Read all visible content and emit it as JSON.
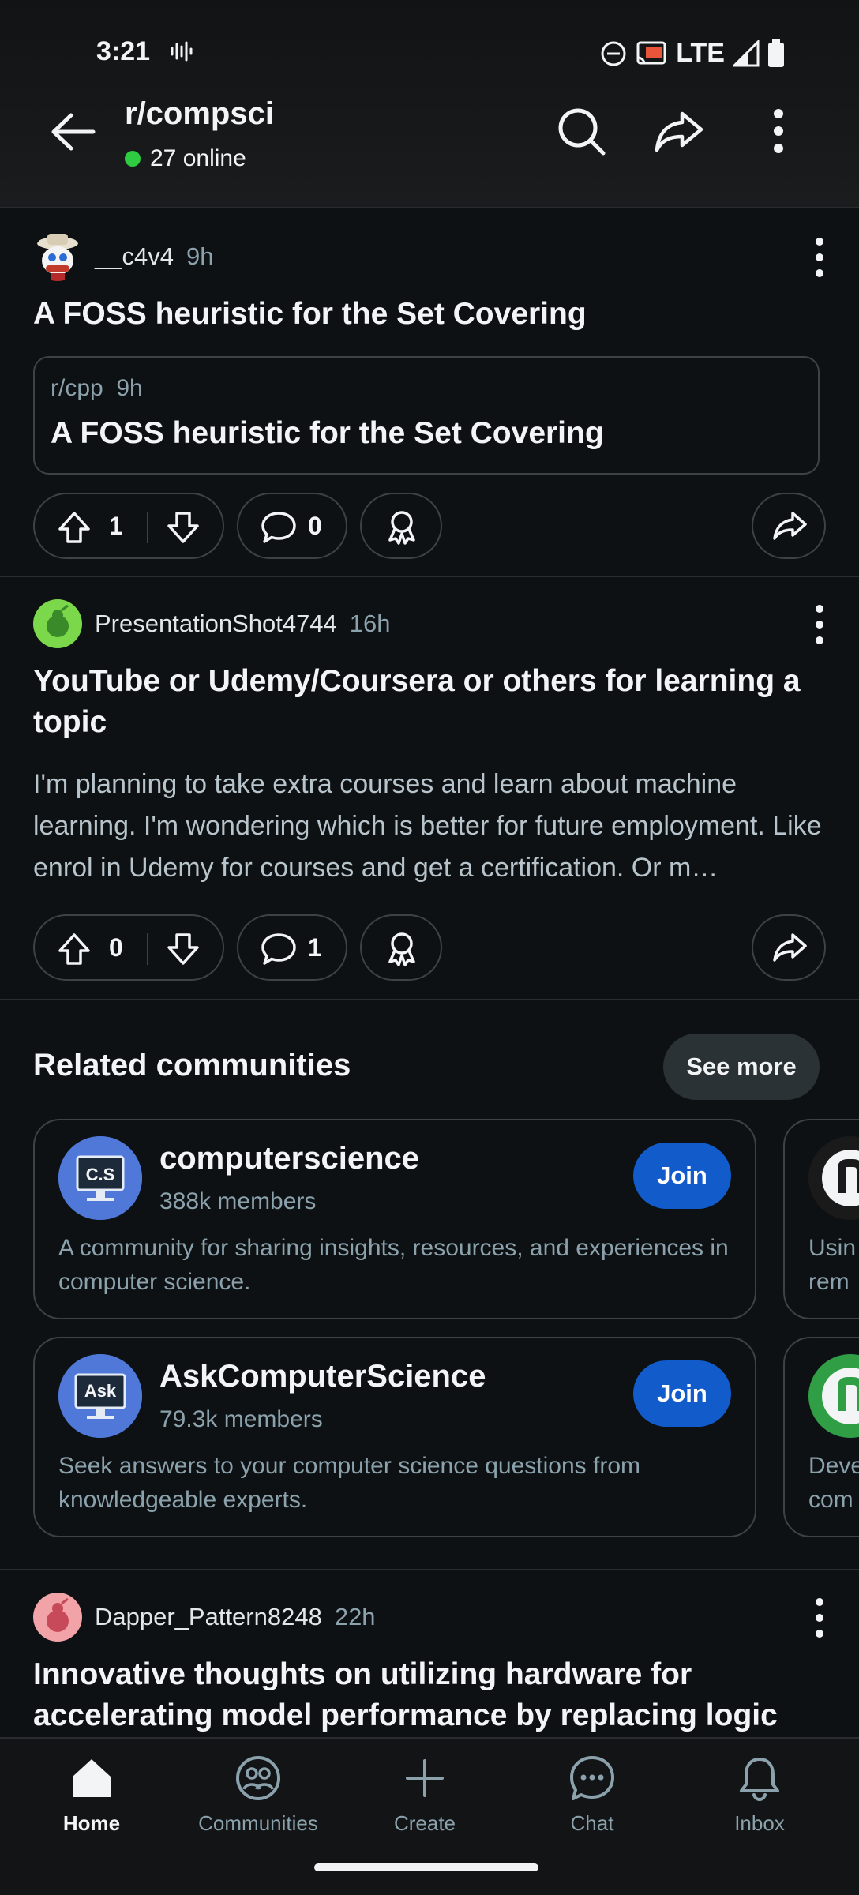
{
  "status_bar": {
    "time": "3:21",
    "network": "LTE"
  },
  "header": {
    "subreddit": "r/compsci",
    "online": "27 online"
  },
  "posts": [
    {
      "author": "__c4v4",
      "age": "9h",
      "title": "A FOSS heuristic for the Set Covering",
      "crosspost": {
        "source": "r/cpp",
        "age": "9h",
        "title": "A FOSS heuristic for the Set Covering"
      },
      "votes": "1",
      "comments": "0"
    },
    {
      "author": "PresentationShot4744",
      "age": "16h",
      "title": "YouTube or Udemy/Coursera or others for learning a topic",
      "body": "I'm planning to take extra courses and learn about machine learning. I'm wondering which is better for future employment. Like enrol in Udemy for courses and get a certification. Or m…",
      "votes": "0",
      "comments": "1"
    },
    {
      "author": "Dapper_Pattern8248",
      "age": "22h",
      "title": "Innovative thoughts on utilizing hardware for accelerating model performance by replacing logic"
    }
  ],
  "related": {
    "title": "Related communities",
    "see_more": "See more",
    "communities": [
      {
        "name": "computerscience",
        "members": "388k members",
        "join": "Join",
        "icon_text": "C.S",
        "description": "A community for sharing insights, resources, and experiences in computer science."
      },
      {
        "name": "AskComputerScience",
        "members": "79.3k members",
        "join": "Join",
        "icon_text": "Ask",
        "description": "Seek answers to your computer science questions from knowledgeable experts."
      }
    ],
    "peek": [
      {
        "line1": "Usin",
        "line2": "rem"
      },
      {
        "line1": "Deve",
        "line2": "com"
      }
    ]
  },
  "nav": [
    {
      "label": "Home",
      "icon": "home-icon"
    },
    {
      "label": "Communities",
      "icon": "communities-icon"
    },
    {
      "label": "Create",
      "icon": "plus-icon"
    },
    {
      "label": "Chat",
      "icon": "chat-icon"
    },
    {
      "label": "Inbox",
      "icon": "bell-icon"
    }
  ],
  "colors": {
    "background": "#0e1113",
    "join": "#115bca",
    "online": "#2ecc40",
    "muted": "#8ba2ad"
  }
}
